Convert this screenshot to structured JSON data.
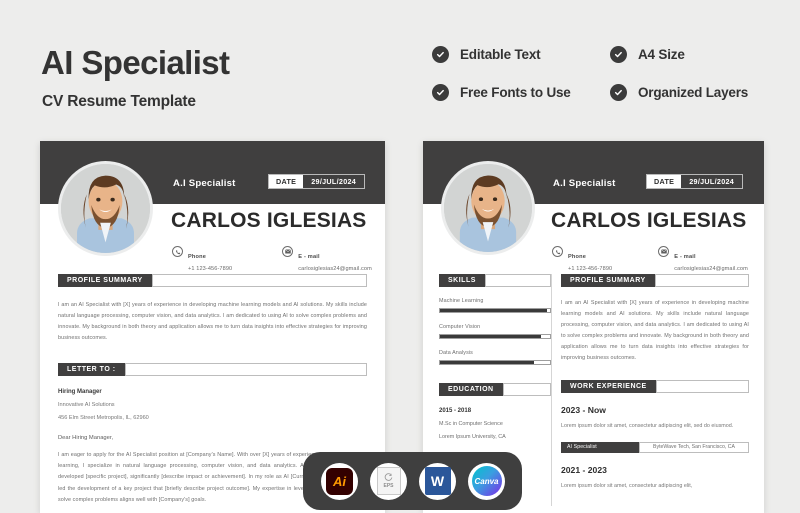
{
  "promo": {
    "title": "AI Specialist",
    "subtitle": "CV Resume Template",
    "features": [
      "Editable Text",
      "A4 Size",
      "Free Fonts to Use",
      "Organized Layers"
    ]
  },
  "resume": {
    "role": "A.I Specialist",
    "date_label": "DATE",
    "date_value": "29/JUL/2024",
    "name": "CARLOS IGLESIAS",
    "phone_label": "Phone",
    "phone_value": "+1 123-456-7890",
    "email_label": "E - mail",
    "email_value": "carlosiglesias24@gmail.com",
    "profile_heading": "PROFILE SUMMARY",
    "profile_text": "I am an AI Specialist with [X] years of experience in developing machine learning models and AI solutions. My skills include natural language processing, computer vision, and data analytics. I am dedicated to using AI to solve complex problems and innovate. My background in both theory and application allows me to turn data insights into effective strategies for improving business outcomes.",
    "letter_heading": "LETTER TO :",
    "letter_recipient": "Hiring Manager",
    "letter_company": "Innovative AI Solutions",
    "letter_address": "456 Elm Street Metropolis, IL, 62960",
    "letter_greeting": "Dear Hiring Manager,",
    "letter_body": "I am eager to apply for the AI Specialist position at [Company's Name]. With over [X] years of experience in AI and machine learning, I specialize in natural language processing, computer vision, and data analytics. At [Previous Company], I developed [specific project], significantly [describe impact or achievement]. In my role as AI [Current/Previous Company], I led the development of a key project that [briefly describe project outcome]. My expertise in leveraging AI technologies to solve complex problems aligns well with [Company's] goals.",
    "skills_heading": "SKILLS",
    "skills": [
      {
        "name": "Machine Learning",
        "level": 97
      },
      {
        "name": "Computer Vision",
        "level": 92
      },
      {
        "name": "Data Analysis",
        "level": 85
      }
    ],
    "education_heading": "EDUCATION",
    "education": [
      {
        "years": "2015 - 2018",
        "degree": "M.Sc in Computer Science",
        "school": "Lorem Ipsum University, CA"
      }
    ],
    "experience_heading": "WORK EXPERIENCE",
    "experience": [
      {
        "years": "2023 - Now",
        "desc": "Lorem ipsum dolor sit amet, consectetur adipiscing elit, sed do eiusmod.",
        "role": "AI Specialist",
        "company": "ByteWave Tech, San Francisco, CA"
      },
      {
        "years": "2021 - 2023",
        "desc": "Lorem ipsum dolor sit amet, consectetur adipiscing elit,",
        "role": "",
        "company": ""
      }
    ]
  },
  "formats": [
    {
      "name": "Adobe Illustrator",
      "short": "Ai"
    },
    {
      "name": "EPS",
      "short": "EPS"
    },
    {
      "name": "Microsoft Word",
      "short": "W"
    },
    {
      "name": "Canva",
      "short": "Canva"
    }
  ],
  "colors": {
    "dark": "#403f3f",
    "background": "#ededec",
    "accent_orange": "#ff9a00",
    "word_blue": "#2b579a"
  }
}
